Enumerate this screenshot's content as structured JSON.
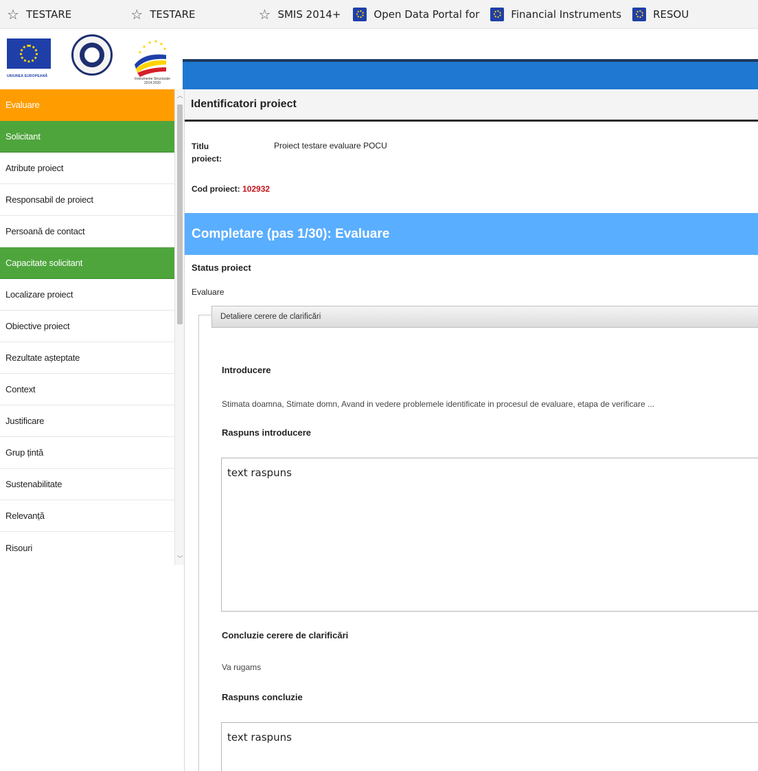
{
  "bookmarks": [
    {
      "label": "TESTARE",
      "icon": "star-icon"
    },
    {
      "label": "TESTARE",
      "icon": "star-icon"
    },
    {
      "label": "SMIS 2014+",
      "icon": "star-icon"
    },
    {
      "label": "Open Data Portal for",
      "icon": "eu-flag-icon"
    },
    {
      "label": "Financial Instruments",
      "icon": "eu-flag-icon"
    },
    {
      "label": "RESOU",
      "icon": "eu-flag-icon"
    }
  ],
  "logos": {
    "eu_caption": "UNIUNEA EUROPEANĂ",
    "si_caption_1": "Instrumente Structurale",
    "si_caption_2": "2014-2020"
  },
  "sidebar": {
    "items": [
      {
        "label": "Evaluare",
        "state": "active"
      },
      {
        "label": "Solicitant",
        "state": "green"
      },
      {
        "label": "Atribute proiect",
        "state": "normal"
      },
      {
        "label": "Responsabil de proiect",
        "state": "normal"
      },
      {
        "label": "Persoană de contact",
        "state": "normal"
      },
      {
        "label": "Capacitate solicitant",
        "state": "green"
      },
      {
        "label": "Localizare proiect",
        "state": "normal"
      },
      {
        "label": "Obiective proiect",
        "state": "normal"
      },
      {
        "label": "Rezultate așteptate",
        "state": "normal"
      },
      {
        "label": "Context",
        "state": "normal"
      },
      {
        "label": "Justificare",
        "state": "normal"
      },
      {
        "label": "Grup țintă",
        "state": "normal"
      },
      {
        "label": "Sustenabilitate",
        "state": "normal"
      },
      {
        "label": "Relevanță",
        "state": "normal"
      },
      {
        "label": "Risouri",
        "state": "normal"
      }
    ]
  },
  "main": {
    "ident_title": "Identificatori proiect",
    "titlu_label": "Titlu proiect:",
    "titlu_value": "Proiect testare evaluare POCU",
    "cod_label": "Cod proiect:",
    "cod_value": "102932",
    "step_title": "Completare (pas 1/30): Evaluare",
    "status_label": "Status proiect",
    "status_value": "Evaluare",
    "fieldset_title": "Detaliere cerere de clarificări",
    "introducere_label": "Introducere",
    "introducere_text": "Stimata doamna, Stimate domn, Avand in vedere problemele identificate in procesul de evaluare, etapa de verificare ...",
    "raspuns_intro_label": "Raspuns introducere",
    "raspuns_intro_value": "text raspuns",
    "concluzie_label": "Concluzie cerere de clarificări",
    "concluzie_text": "Va rugams",
    "raspuns_concluzie_label": "Raspuns concluzie",
    "raspuns_concluzie_value": "text raspuns"
  },
  "colors": {
    "active": "#ff9d00",
    "completed": "#4ea53c",
    "header_blue": "#1f78d1",
    "step_blue": "#5aaeff",
    "code_red": "#c0141c"
  }
}
